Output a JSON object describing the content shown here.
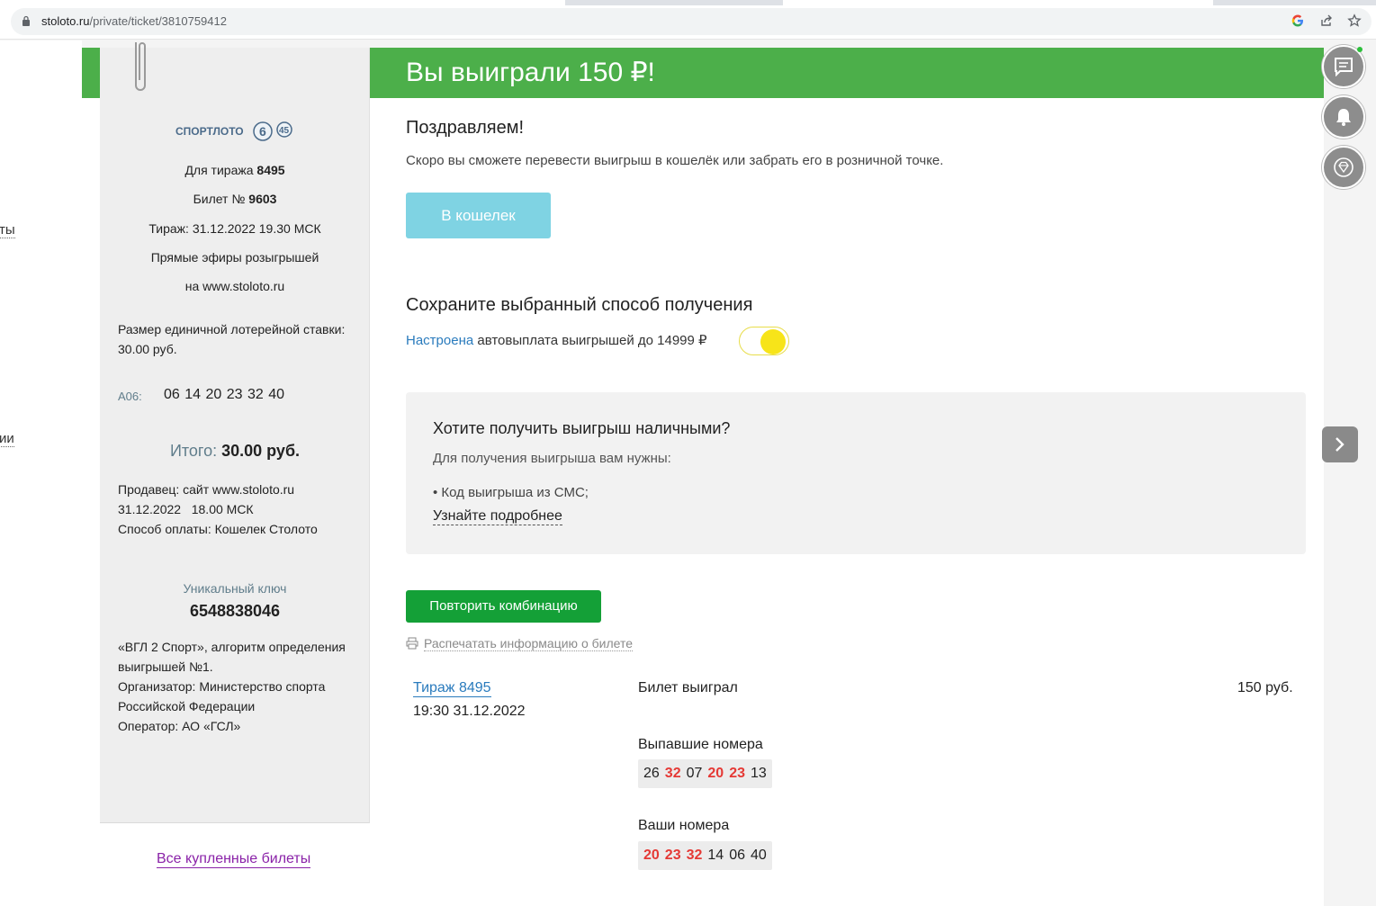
{
  "browser": {
    "url_host": "stoloto.ru",
    "url_path": "/private/ticket/3810759412"
  },
  "left_fragments": [
    "ты",
    "ии"
  ],
  "banner": {
    "title": "Вы выиграли 150 ₽!"
  },
  "ticket": {
    "draw_prefix": "Для тиража ",
    "draw_number": "8495",
    "ticket_prefix": "Билет № ",
    "ticket_number": "9603",
    "draw_datetime": "Тираж: 31.12.2022 19.30 МСК",
    "live_line1": "Прямые эфиры розыгрышей",
    "live_line2": "на www.stoloto.ru",
    "stake_line1": "Размер единичной лотерейной ставки:",
    "stake_line2": "30.00 руб.",
    "combo_label": "А06:",
    "combo_numbers": "06 14 20 23 32 40",
    "total_label": "Итого: ",
    "total_value": "30.00 руб.",
    "seller_line1": "Продавец: сайт www.stoloto.ru",
    "seller_line2": "31.12.2022   18.00 МСК",
    "seller_line3": "Способ оплаты: Кошелек Столото",
    "unique_key_label": "Уникальный ключ",
    "unique_key": "6548838046",
    "legal_line1": "«ВГЛ 2 Спорт», алгоритм определения",
    "legal_line2": "выигрышей №1.",
    "legal_line3": "Организатор: Министерство спорта",
    "legal_line4": "Российской Федерации",
    "legal_line5": "Оператор: АО «ГСЛ»",
    "logo_text": "СПОРТЛОТО",
    "logo_num1": "6",
    "logo_num2": "45"
  },
  "all_tickets_link": "Все купленные билеты",
  "content": {
    "congrats": "Поздравляем!",
    "subtitle": "Скоро вы сможете перевести выигрыш в кошелёк или забрать его в розничной точке.",
    "wallet_button": "В кошелек",
    "save_heading": "Сохраните выбранный способ получения",
    "autopay_link": "Настроена",
    "autopay_text": " автовыплата выигрышей до 14999 ₽",
    "autopay_enabled": true,
    "cash": {
      "heading": "Хотите получить выигрыш наличными?",
      "intro": "Для получения выигрыша вам нужны:",
      "item": "• Код выигрыша из СМС;",
      "more_link": "Узнайте подробнее"
    },
    "repeat_button": "Повторить комбинацию",
    "print_link": "Распечатать информацию о билете",
    "result": {
      "draw_link": "Тираж 8495",
      "draw_time": "19:30 31.12.2022",
      "status": "Билет выиграл",
      "prize": "150 руб.",
      "dropped_label": "Выпавшие номера",
      "dropped_numbers": [
        {
          "n": "26",
          "hit": false
        },
        {
          "n": "32",
          "hit": true
        },
        {
          "n": "07",
          "hit": false
        },
        {
          "n": "20",
          "hit": true
        },
        {
          "n": "23",
          "hit": true
        },
        {
          "n": "13",
          "hit": false
        }
      ],
      "yours_label": "Ваши номера",
      "your_numbers": [
        {
          "n": "20",
          "hit": true
        },
        {
          "n": "23",
          "hit": true
        },
        {
          "n": "32",
          "hit": true
        },
        {
          "n": "14",
          "hit": false
        },
        {
          "n": "06",
          "hit": false
        },
        {
          "n": "40",
          "hit": false
        }
      ]
    }
  },
  "side_icons": [
    "chat-icon",
    "bell-icon",
    "diamond-icon"
  ],
  "colors": {
    "banner_green": "#4caf4a",
    "repeat_green": "#14a037",
    "wallet_blue": "#7fd3e3",
    "hit_red": "#e53935",
    "toggle_yellow": "#f7e419"
  }
}
